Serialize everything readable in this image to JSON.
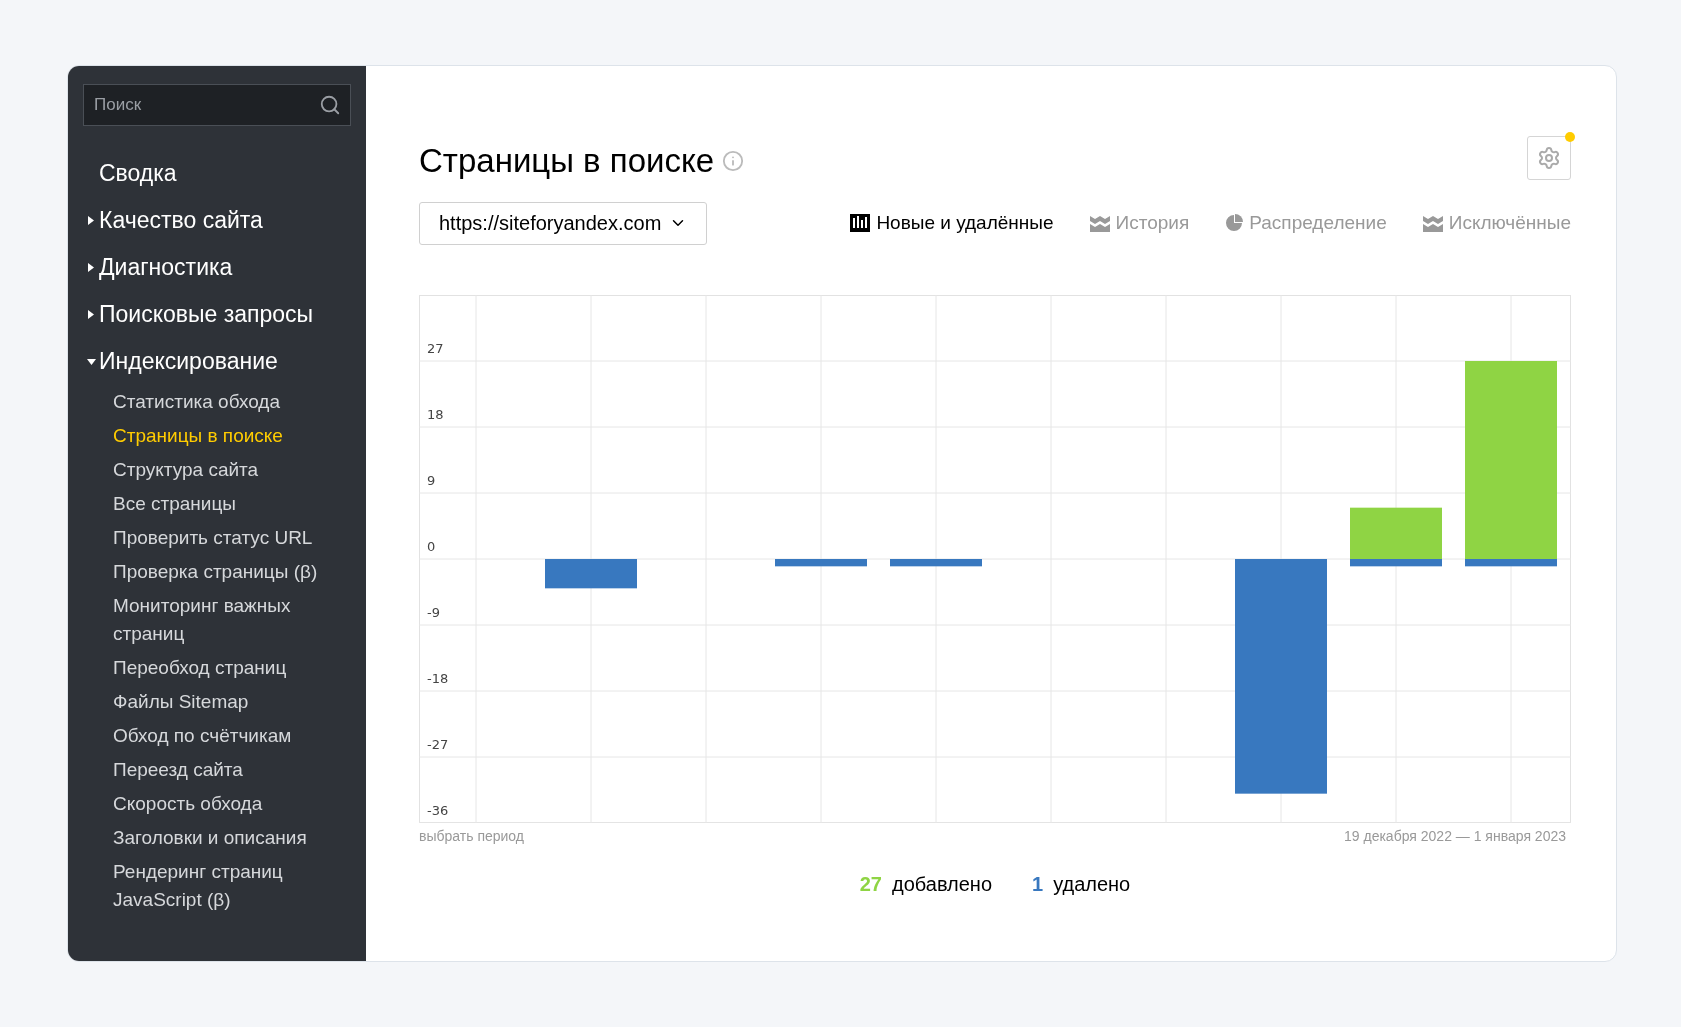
{
  "sidebar": {
    "search": {
      "placeholder": "Поиск"
    },
    "items": [
      {
        "label": "Сводка",
        "kind": "link"
      },
      {
        "label": "Качество сайта",
        "kind": "group",
        "expanded": false
      },
      {
        "label": "Диагностика",
        "kind": "group",
        "expanded": false
      },
      {
        "label": "Поисковые запросы",
        "kind": "group",
        "expanded": false
      },
      {
        "label": "Индексирование",
        "kind": "group",
        "expanded": true,
        "children": [
          {
            "label": "Статистика обхода",
            "selected": false
          },
          {
            "label": "Страницы в поиске",
            "selected": true
          },
          {
            "label": "Структура сайта",
            "selected": false
          },
          {
            "label": "Все страницы",
            "selected": false
          },
          {
            "label": "Проверить статус URL",
            "selected": false
          },
          {
            "label": "Проверка страницы (β)",
            "selected": false
          },
          {
            "label": "Мониторинг важных страниц",
            "selected": false
          },
          {
            "label": "Переобход страниц",
            "selected": false
          },
          {
            "label": "Файлы Sitemap",
            "selected": false
          },
          {
            "label": "Обход по счётчикам",
            "selected": false
          },
          {
            "label": "Переезд сайта",
            "selected": false
          },
          {
            "label": "Скорость обхода",
            "selected": false
          },
          {
            "label": "Заголовки и описания",
            "selected": false
          },
          {
            "label": "Рендеринг страниц JavaScript (β)",
            "selected": false
          }
        ]
      }
    ]
  },
  "page": {
    "title": "Страницы в поиске",
    "site_select": "https://siteforyandex.com",
    "tabs": [
      {
        "label": "Новые и удалённые",
        "kind": "bars",
        "selected": true
      },
      {
        "label": "История",
        "kind": "waves",
        "selected": false
      },
      {
        "label": "Распределение",
        "kind": "pie",
        "selected": false
      },
      {
        "label": "Исключённые",
        "kind": "waves",
        "selected": false
      }
    ],
    "chart": {
      "period_link": "выбрать период",
      "date_range": "19 декабря 2022 — 1 января 2023",
      "chart_data": {
        "type": "bar",
        "stacked": true,
        "grid": true,
        "ylim": [
          -36,
          36
        ],
        "yticks": [
          27,
          18,
          9,
          0,
          -9,
          -18,
          -27,
          -36
        ],
        "series": [
          {
            "name": "добавлено",
            "color": "#8fd444",
            "values": [
              0,
              0,
              0,
              0,
              0,
              0,
              0,
              0,
              7,
              27
            ]
          },
          {
            "name": "удалено",
            "color": "#3878bf",
            "values": [
              0,
              -4,
              0,
              -1,
              -1,
              0,
              0,
              -32,
              -1,
              -1
            ]
          }
        ]
      }
    },
    "summary": [
      {
        "value": "27"
      },
      {
        "value": "1"
      }
    ]
  }
}
